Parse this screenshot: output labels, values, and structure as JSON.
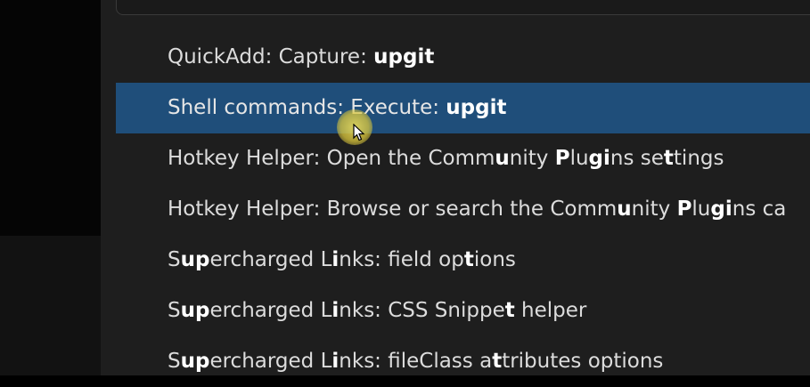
{
  "palette": {
    "search_value": "upgit",
    "suggestions": [
      {
        "segments": [
          {
            "t": "QuickAdd: Capture: ",
            "b": false
          },
          {
            "t": "upgit",
            "b": true
          }
        ]
      },
      {
        "selected": true,
        "segments": [
          {
            "t": "Shell commands: Execute: ",
            "b": false
          },
          {
            "t": "upgit",
            "b": true
          }
        ]
      },
      {
        "segments": [
          {
            "t": "Hotkey Helper: Open the Comm",
            "b": false
          },
          {
            "t": "u",
            "b": true
          },
          {
            "t": "nity ",
            "b": false
          },
          {
            "t": "P",
            "b": true
          },
          {
            "t": "lu",
            "b": false
          },
          {
            "t": "gi",
            "b": true
          },
          {
            "t": "ns se",
            "b": false
          },
          {
            "t": "t",
            "b": true
          },
          {
            "t": "tings",
            "b": false
          }
        ]
      },
      {
        "segments": [
          {
            "t": "Hotkey Helper: Browse or search the Comm",
            "b": false
          },
          {
            "t": "u",
            "b": true
          },
          {
            "t": "nity ",
            "b": false
          },
          {
            "t": "P",
            "b": true
          },
          {
            "t": "lu",
            "b": false
          },
          {
            "t": "gi",
            "b": true
          },
          {
            "t": "ns ca",
            "b": false
          }
        ]
      },
      {
        "segments": [
          {
            "t": "S",
            "b": false
          },
          {
            "t": "up",
            "b": true
          },
          {
            "t": "ercharged L",
            "b": false
          },
          {
            "t": "i",
            "b": true
          },
          {
            "t": "nks: field op",
            "b": false
          },
          {
            "t": "t",
            "b": true
          },
          {
            "t": "ions",
            "b": false
          }
        ]
      },
      {
        "segments": [
          {
            "t": "S",
            "b": false
          },
          {
            "t": "up",
            "b": true
          },
          {
            "t": "ercharged L",
            "b": false
          },
          {
            "t": "i",
            "b": true
          },
          {
            "t": "nks: CSS Snippe",
            "b": false
          },
          {
            "t": "t",
            "b": true
          },
          {
            "t": " helper",
            "b": false
          }
        ]
      },
      {
        "segments": [
          {
            "t": "S",
            "b": false
          },
          {
            "t": "up",
            "b": true
          },
          {
            "t": "ercharged L",
            "b": false
          },
          {
            "t": "i",
            "b": true
          },
          {
            "t": "nks: fileClass a",
            "b": false
          },
          {
            "t": "t",
            "b": true
          },
          {
            "t": "tributes options",
            "b": false
          }
        ]
      }
    ]
  },
  "colors": {
    "selected_background": "#1f4e7a",
    "palette_background": "#1e1e1e",
    "cursor_highlight": "#e6d45a"
  },
  "icons": {
    "pointer": "mouse-pointer-icon"
  }
}
